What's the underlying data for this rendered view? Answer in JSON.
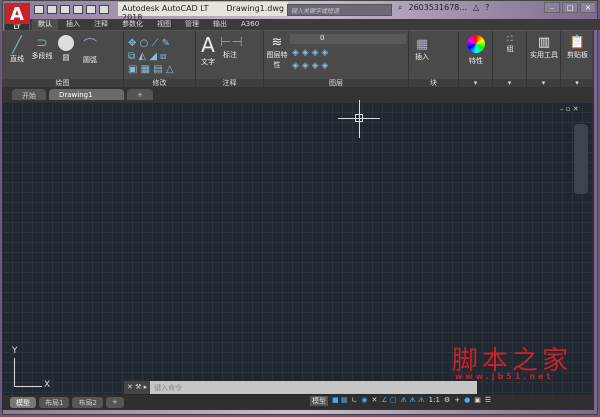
{
  "app": {
    "logo": "A",
    "logo_sub": "LT",
    "title": "Autodesk AutoCAD LT 2018",
    "file": "Drawing1.dwg",
    "search_placeholder": "键入关键字或短语",
    "user": "2603531678...",
    "min": "–",
    "max": "□",
    "close": "✕"
  },
  "ribbon_tabs": [
    "默认",
    "插入",
    "注释",
    "参数化",
    "视图",
    "管理",
    "输出",
    "A360"
  ],
  "panels": {
    "draw": "绘图",
    "modify": "修改",
    "annotate": "注释",
    "layers": "图层",
    "block": "块",
    "properties": "特性",
    "groups": "组",
    "utilities": "实用工具",
    "clipboard": "剪贴板"
  },
  "tools": {
    "line": "直线",
    "polyline": "多段线",
    "circle": "圆",
    "arc": "圆弧",
    "text": "文字",
    "dimension": "标注",
    "layer_props": "图层特性",
    "insert": "插入",
    "layer_value": "0"
  },
  "doc_tabs": [
    "开始",
    "Drawing1"
  ],
  "layout_tabs": [
    "模型",
    "布局1",
    "布局2",
    "+"
  ],
  "command": {
    "placeholder": "键入命令"
  },
  "status": {
    "model": "模型",
    "scale": "1:1"
  },
  "watermark": {
    "text": "脚本之家",
    "url": "www.jb51.net"
  },
  "ucs": {
    "x": "X",
    "y": "Y"
  }
}
